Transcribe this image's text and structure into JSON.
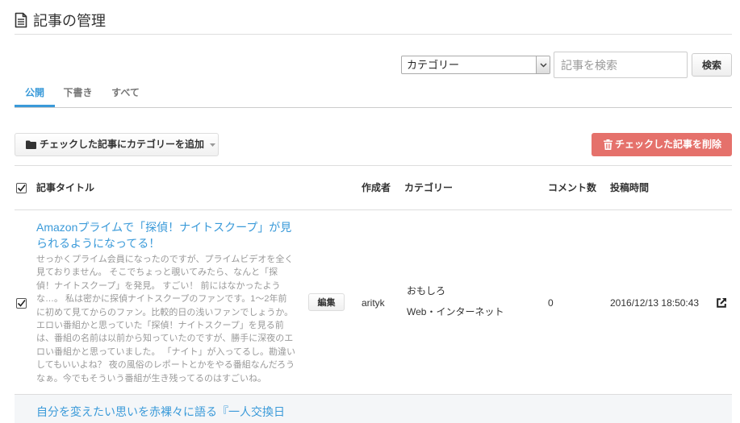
{
  "header": {
    "title": "記事の管理",
    "icon": "document-icon"
  },
  "filter": {
    "category_select": {
      "selected": "カテゴリー",
      "icon": "chevron-down-icon"
    },
    "search": {
      "placeholder": "記事を検索"
    },
    "search_button": "検索"
  },
  "tabs": [
    {
      "label": "公開",
      "active": true
    },
    {
      "label": "下書き",
      "active": false
    },
    {
      "label": "すべて",
      "active": false
    }
  ],
  "toolbar": {
    "add_category_label": "チェックした記事にカテゴリーを追加",
    "add_category_icon": "folder-icon",
    "delete_label": "チェックした記事を削除",
    "delete_icon": "trash-icon"
  },
  "table": {
    "select_all_checked": true,
    "columns": {
      "title": "記事タイトル",
      "author": "作成者",
      "category": "カテゴリー",
      "comments": "コメント数",
      "posted_at": "投稿時間"
    }
  },
  "articles": [
    {
      "checked": true,
      "title": "Amazonプライムで「探偵！ナイトスクープ」が見られるようになってる！",
      "excerpt": "せっかくプライム会員になったのですが、プライムビデオを全く見ておりません。 そこでちょっと覗いてみたら、なんと「探偵！ナイトスクープ」を発見。 すごい！ 前にはなかったような…。 私は密かに探偵ナイトスクープのファンです。1〜2年前に初めて見てからのファン。比較的日の浅いファンでしょうか。 エロい番組かと思っていた「探偵！ナイトスクープ」を見る前は、番組の名前は以前から知っていたのですが、勝手に深夜のエロい番組かと思っていました。 「ナイト」が入ってるし。勘違いしてもいいよね？ 夜の風俗のレポートとかをやる番組なんだろうなぁ。今でもそういう番組が生き残ってるのはすごいね。",
      "edit_label": "編集",
      "author": "arityk",
      "categories": [
        "おもしろ",
        "Web・インターネット"
      ],
      "comment_count": "0",
      "posted_at": "2016/12/13 18:50:43",
      "link_icon": "external-link-icon"
    },
    {
      "title": "自分を変えたい思いを赤裸々に語る『一人交換日"
    }
  ],
  "colors": {
    "accent": "#3a9ad9",
    "danger": "#e5716b",
    "text": "#333333",
    "muted": "#999999",
    "border": "#dddddd",
    "row_alt_bg": "#f4f6f8"
  }
}
